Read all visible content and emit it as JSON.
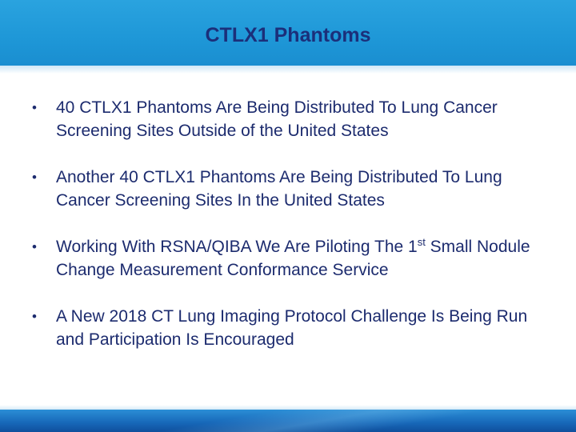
{
  "slide": {
    "title": "CTLX1 Phantoms",
    "bullet_symbol": "•",
    "bullets": [
      {
        "text_before": "40 CTLX1 Phantoms Are Being Distributed To Lung Cancer Screening Sites Outside of the United States"
      },
      {
        "text_before": "Another 40 CTLX1 Phantoms Are Being Distributed To Lung Cancer Screening Sites In the United States"
      },
      {
        "text_before": "Working With RSNA/QIBA We Are Piloting The 1",
        "superscript": "st",
        "text_after": " Small Nodule Change Measurement Conformance Service"
      },
      {
        "text_before": "A New 2018 CT Lung Imaging Protocol Challenge Is Being Run and Participation Is Encouraged"
      }
    ]
  },
  "colors": {
    "header_blue": "#1e97d7",
    "title_navy": "#1b2f7a",
    "text_navy": "#1c2b6e",
    "footer_blue": "#1767b8"
  }
}
